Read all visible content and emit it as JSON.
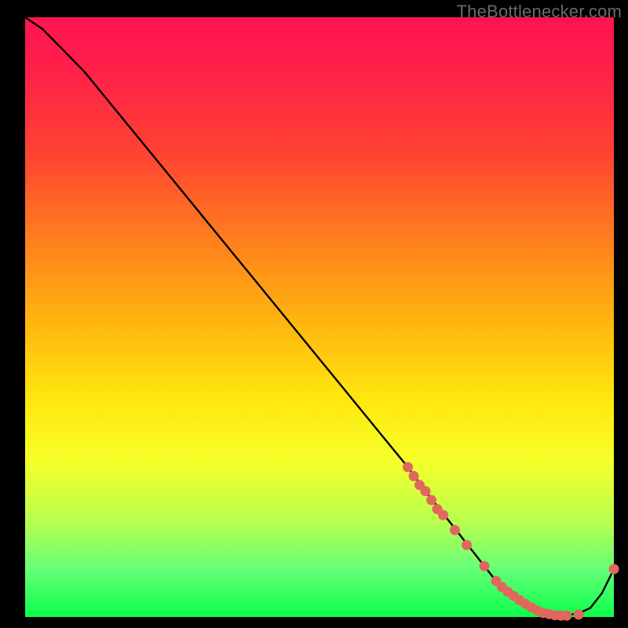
{
  "watermark": "TheBottlenecker.com",
  "colors": {
    "curve": "#000000",
    "dot_fill": "#e0675e",
    "dot_stroke": "#c44d46",
    "gradient_top": "#ff1450",
    "gradient_bottom": "#0cff4a"
  },
  "chart_data": {
    "type": "line",
    "title": "",
    "xlabel": "",
    "ylabel": "",
    "xlim": [
      0,
      100
    ],
    "ylim": [
      0,
      100
    ],
    "grid": false,
    "legend": false,
    "series": [
      {
        "name": "bottleneck-curve",
        "x": [
          0,
          3,
          6,
          10,
          15,
          20,
          25,
          30,
          35,
          40,
          45,
          50,
          55,
          60,
          65,
          68,
          72,
          76,
          80,
          83,
          86,
          88,
          90,
          92,
          94,
          96,
          98,
          100
        ],
        "values": [
          100,
          98,
          95,
          91,
          85,
          79,
          73,
          67,
          61,
          55,
          49,
          43,
          37,
          31,
          25,
          21,
          16,
          11,
          6,
          3,
          1,
          0.4,
          0.2,
          0.3,
          0.6,
          1.5,
          4,
          8
        ]
      }
    ],
    "scatter_points": {
      "name": "highlighted-segment",
      "x": [
        65,
        66,
        67,
        68,
        69,
        70,
        71,
        73,
        75,
        78,
        80,
        81,
        82,
        83,
        84,
        85,
        86,
        87,
        88,
        89,
        90,
        91,
        92,
        94,
        100
      ],
      "values": [
        25,
        23.5,
        22,
        21,
        19.5,
        18,
        17,
        14.5,
        12,
        8.5,
        6,
        5,
        4.2,
        3.5,
        2.8,
        2.2,
        1.6,
        1.1,
        0.7,
        0.5,
        0.3,
        0.25,
        0.25,
        0.4,
        8
      ]
    },
    "background": "red-yellow-green vertical gradient"
  }
}
